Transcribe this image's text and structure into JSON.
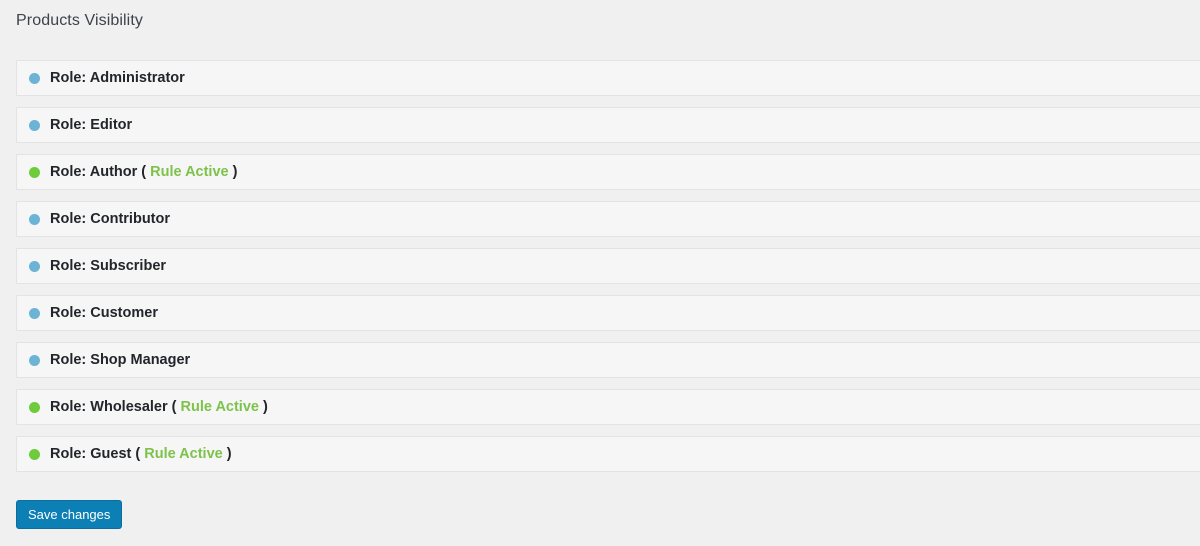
{
  "page": {
    "title": "Products Visibility",
    "background_color": "#f0f0f1"
  },
  "colors": {
    "dot_inactive": "#6db3d6",
    "dot_active": "#6ecc3c",
    "rule_active_text": "#7dc24b",
    "button_primary": "#0c7fb5",
    "row_background": "#f6f6f6",
    "row_border": "#e3e3e3",
    "title_text": "#3c434a",
    "label_text": "#22252a"
  },
  "rules": [
    {
      "label": "Role: Administrator",
      "status": "inactive",
      "dot_name": "status-dot-inactive",
      "active_text": "",
      "paren_open": "",
      "paren_close": ""
    },
    {
      "label": "Role: Editor",
      "status": "inactive",
      "dot_name": "status-dot-inactive",
      "active_text": "",
      "paren_open": "",
      "paren_close": ""
    },
    {
      "label": "Role: Author",
      "status": "active",
      "dot_name": "status-dot-active",
      "active_text": "Rule Active",
      "paren_open": " ( ",
      "paren_close": " )"
    },
    {
      "label": "Role: Contributor",
      "status": "inactive",
      "dot_name": "status-dot-inactive",
      "active_text": "",
      "paren_open": "",
      "paren_close": ""
    },
    {
      "label": "Role: Subscriber",
      "status": "inactive",
      "dot_name": "status-dot-inactive",
      "active_text": "",
      "paren_open": "",
      "paren_close": ""
    },
    {
      "label": "Role: Customer",
      "status": "inactive",
      "dot_name": "status-dot-inactive",
      "active_text": "",
      "paren_open": "",
      "paren_close": ""
    },
    {
      "label": "Role: Shop Manager",
      "status": "inactive",
      "dot_name": "status-dot-inactive",
      "active_text": "",
      "paren_open": "",
      "paren_close": ""
    },
    {
      "label": "Role: Wholesaler",
      "status": "active",
      "dot_name": "status-dot-active",
      "active_text": "Rule Active",
      "paren_open": " ( ",
      "paren_close": " )"
    },
    {
      "label": "Role: Guest",
      "status": "active",
      "dot_name": "status-dot-active",
      "active_text": "Rule Active",
      "paren_open": " ( ",
      "paren_close": " )"
    }
  ],
  "footer": {
    "save_label": "Save changes"
  }
}
